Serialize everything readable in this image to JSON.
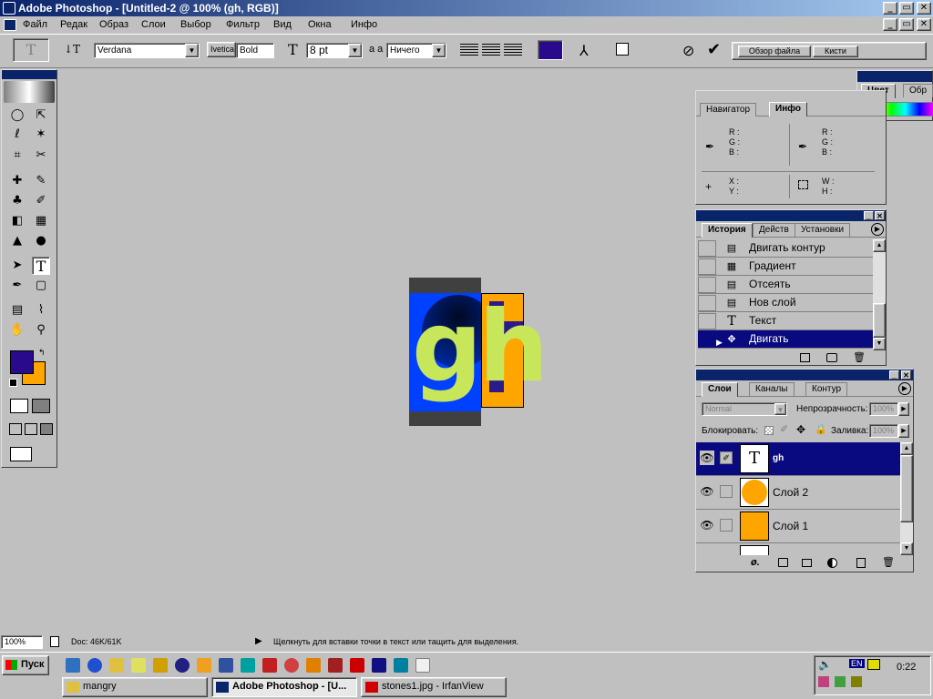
{
  "window": {
    "title": "Adobe Photoshop - [Untitled-2 @ 100% (gh, RGB)]",
    "controls": [
      "_",
      "▭",
      "✕"
    ]
  },
  "doc_controls": [
    "_",
    "▭",
    "✕"
  ],
  "menu": [
    "Файл",
    "Редак",
    "Образ",
    "Слои",
    "Выбор",
    "Фильтр",
    "Вид",
    "Окна",
    "Инфо"
  ],
  "options": {
    "tool_glyph": "T",
    "font_family": "Verdana",
    "font_style_label": "Ivetica",
    "font_style": "Bold",
    "font_size": "8 pt",
    "antialias_label": "a a",
    "antialias": "Ничего",
    "color": "#2a0a8c"
  },
  "dock_tabs": [
    "Обзор файла",
    "Кисти"
  ],
  "color_palette": {
    "tabs": [
      "Цвет",
      "Обр"
    ]
  },
  "info_palette": {
    "tabs": [
      "Навигатор",
      "Инфо"
    ],
    "rgb1": [
      "R :",
      "G :",
      "B :"
    ],
    "rgb2": [
      "R :",
      "G :",
      "B :"
    ],
    "xy": [
      "X :",
      "Y :"
    ],
    "wh": [
      "W :",
      "H :"
    ]
  },
  "history_palette": {
    "tabs": [
      "История",
      "Действ",
      "Установки"
    ],
    "items": [
      {
        "label": "Двигать контур",
        "icon": "▤"
      },
      {
        "label": "Градиент",
        "icon": "▦"
      },
      {
        "label": "Отсеять",
        "icon": "▤"
      },
      {
        "label": "Нов слой",
        "icon": "▤"
      },
      {
        "label": "Текст",
        "icon": "T"
      },
      {
        "label": "Двигать",
        "icon": "✥"
      }
    ]
  },
  "layers_palette": {
    "tabs": [
      "Слои",
      "Каналы",
      "Контур"
    ],
    "mode": "Normal",
    "opacity_label": "Непрозрачность:",
    "opacity": "100%",
    "lock_label": "Блокировать:",
    "fill_label": "Заливка:",
    "fill": "100%",
    "layers": [
      {
        "name": "gh",
        "type": "text",
        "selected": true
      },
      {
        "name": "Слой 2",
        "type": "circle",
        "selected": false
      },
      {
        "name": "Слой 1",
        "type": "fill",
        "selected": false
      }
    ]
  },
  "canvas": {
    "text": "gh",
    "text_color": "#c8e65a",
    "bg_left": "#0040ff",
    "bg_right": "#ffa500"
  },
  "status": {
    "zoom": "100%",
    "doc": "Doc: 46K/61K",
    "hint": "Щелкнуть для вставки точки в текст или тащить для выделения."
  },
  "taskbar": {
    "start": "Пуск",
    "tasks": [
      "mangry",
      "Adobe Photoshop - [U...",
      "stones1.jpg - IrfanView"
    ],
    "clock": "0:22",
    "lang": "EN"
  }
}
